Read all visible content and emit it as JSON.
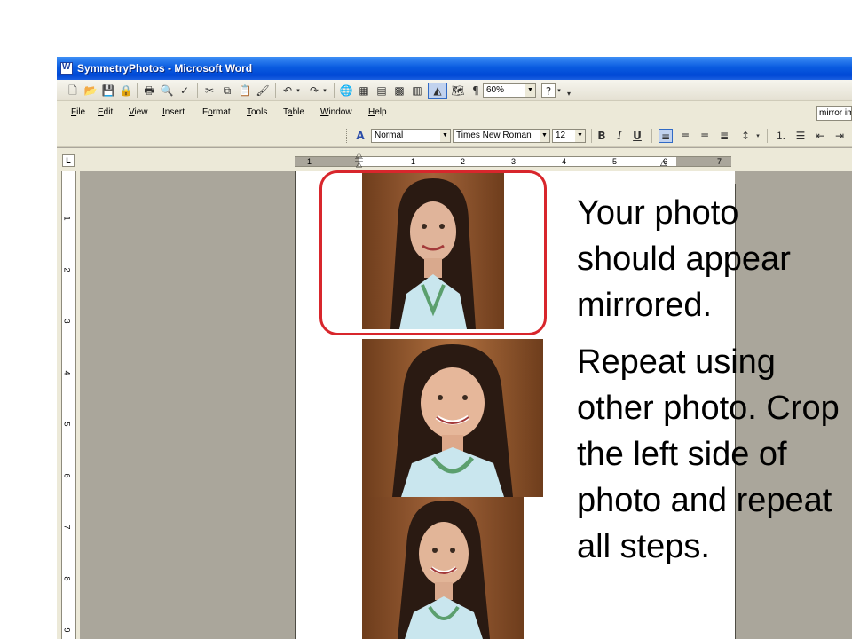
{
  "window": {
    "title": "SymmetryPhotos - Microsoft Word"
  },
  "menu": {
    "items": [
      {
        "label": "File",
        "key": "F"
      },
      {
        "label": "Edit",
        "key": "E"
      },
      {
        "label": "View",
        "key": "V"
      },
      {
        "label": "Insert",
        "key": "I"
      },
      {
        "label": "Format",
        "key": "o"
      },
      {
        "label": "Tools",
        "key": "T"
      },
      {
        "label": "Table",
        "key": "a"
      },
      {
        "label": "Window",
        "key": "W"
      },
      {
        "label": "Help",
        "key": "H"
      }
    ],
    "help_box": "mirror image"
  },
  "standard_toolbar": {
    "zoom": "60%"
  },
  "formatting_toolbar": {
    "style": "Normal",
    "font": "Times New Roman",
    "size": "12",
    "bold": "B",
    "italic": "I",
    "underline": "U"
  },
  "ruler": {
    "tab_selector": "L",
    "h_numbers": [
      "1",
      "1",
      "2",
      "3",
      "4",
      "5",
      "6",
      "7"
    ],
    "v_numbers": [
      "1",
      "2",
      "3",
      "4",
      "5",
      "6",
      "7",
      "8",
      "9"
    ]
  },
  "slide": {
    "line1": "Your photo should appear mirrored.",
    "line2": "Repeat using other photo. Crop the left side of photo and repeat all steps."
  },
  "colors": {
    "highlight": "#d8262c",
    "title_bar": "#0a5ce0",
    "workspace": "#aaa69b"
  }
}
